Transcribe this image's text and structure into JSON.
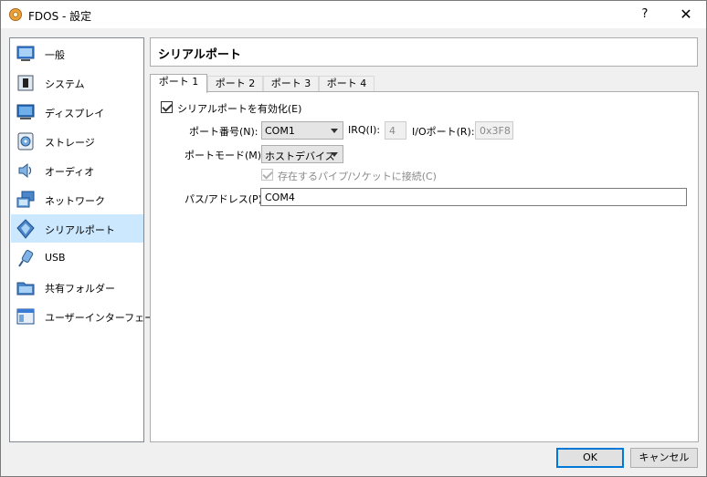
{
  "window": {
    "title": "FDOS - 設定",
    "help_label": "?",
    "close_label": "✕"
  },
  "sidebar": {
    "items": [
      {
        "label": "一般",
        "icon": "general-icon"
      },
      {
        "label": "システム",
        "icon": "system-icon"
      },
      {
        "label": "ディスプレイ",
        "icon": "display-icon"
      },
      {
        "label": "ストレージ",
        "icon": "storage-icon"
      },
      {
        "label": "オーディオ",
        "icon": "audio-icon"
      },
      {
        "label": "ネットワーク",
        "icon": "network-icon"
      },
      {
        "label": "シリアルポート",
        "icon": "serial-port-icon",
        "selected": true
      },
      {
        "label": "USB",
        "icon": "usb-icon"
      },
      {
        "label": "共有フォルダー",
        "icon": "shared-folder-icon"
      },
      {
        "label": "ユーザーインターフェース",
        "icon": "user-interface-icon"
      }
    ]
  },
  "header": {
    "title": "シリアルポート"
  },
  "tabs": [
    {
      "label": "ポート 1",
      "active": true
    },
    {
      "label": "ポート 2"
    },
    {
      "label": "ポート 3"
    },
    {
      "label": "ポート 4"
    }
  ],
  "port": {
    "enable_label": "シリアルポートを有効化(E)",
    "enabled": true,
    "number_label": "ポート番号(N):",
    "number_value": "COM1",
    "irq_label": "IRQ(I):",
    "irq_value": "4",
    "io_label": "I/Oポート(R):",
    "io_value": "0x3F8",
    "mode_label": "ポートモード(M):",
    "mode_value": "ホストデバイス",
    "connect_existing_label": "存在するパイプ/ソケットに接続(C)",
    "connect_existing_checked": true,
    "path_label": "パス/アドレス(P):",
    "path_value": "COM4"
  },
  "footer": {
    "ok_label": "OK",
    "cancel_label": "キャンセル"
  },
  "colors": {
    "selected_bg": "#cce8ff",
    "accent": "#0078d7"
  }
}
